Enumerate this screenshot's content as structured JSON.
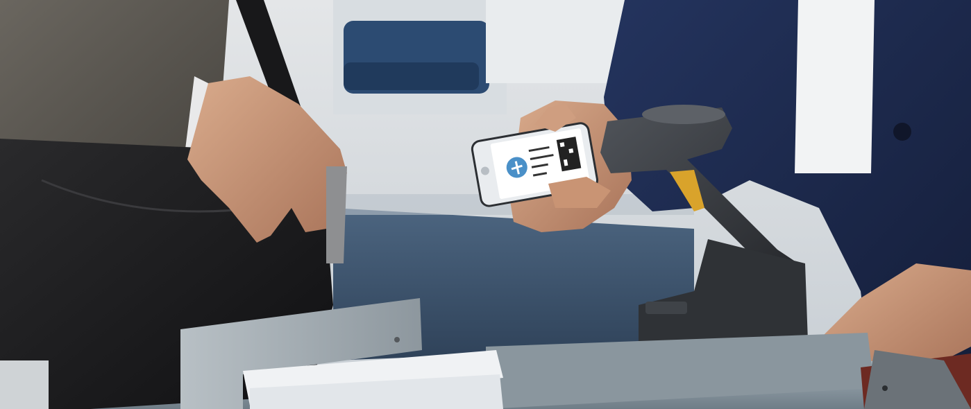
{
  "scene": {
    "description_objects": [
      "passenger-arm",
      "leather-bag",
      "agent-arm",
      "smartphone",
      "barcode-scanner",
      "counter",
      "document-holder"
    ]
  },
  "phone_screen": {
    "logo_text": "",
    "lines": [
      "",
      "",
      "",
      ""
    ]
  },
  "colors": {
    "suit_grey": "#55524d",
    "agent_navy": "#1c2a4f",
    "bag_black": "#1d1d1f",
    "scanner_grey": "#3a3d42",
    "counter_steel": "#8c9aa3",
    "carpet_blue": "#3e556e",
    "skin": "#c99a7c",
    "scanner_trigger": "#d9a32b"
  }
}
